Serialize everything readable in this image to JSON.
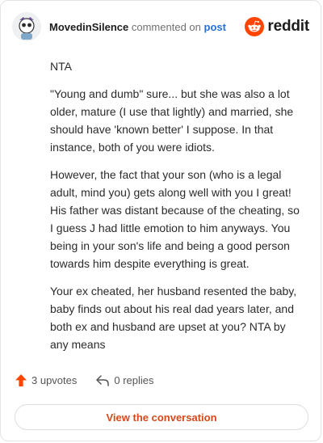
{
  "header": {
    "username": "MovedinSilence",
    "action": "commented on",
    "post_link": "post",
    "brand": "reddit"
  },
  "comment": {
    "paragraphs": [
      "NTA",
      "\"Young and dumb\" sure... but she was also a lot older, mature (I use that lightly) and married, she should have 'known better' I suppose. In that instance, both of you were idiots.",
      "However, the fact that your son (who is a legal adult, mind you) gets along well with you I great! His father was distant because of the cheating, so I guess J had little emotion to him anyways. You being in your son's life and being a good person towards him despite everything is great.",
      "Your ex cheated, her husband resented the baby, baby finds out about his real dad years later, and both ex and husband are upset at you? NTA by any means"
    ]
  },
  "footer": {
    "upvotes": "3 upvotes",
    "replies": "0 replies",
    "cta": "View the conversation"
  },
  "colors": {
    "brand_orange": "#ff4500",
    "link_blue": "#2a6fd6",
    "cta_text": "#d4491a"
  },
  "icons": {
    "avatar": "snoo-avatar",
    "brand": "reddit-logo-icon",
    "upvote": "upvote-arrow-icon",
    "reply": "reply-arrow-icon"
  }
}
